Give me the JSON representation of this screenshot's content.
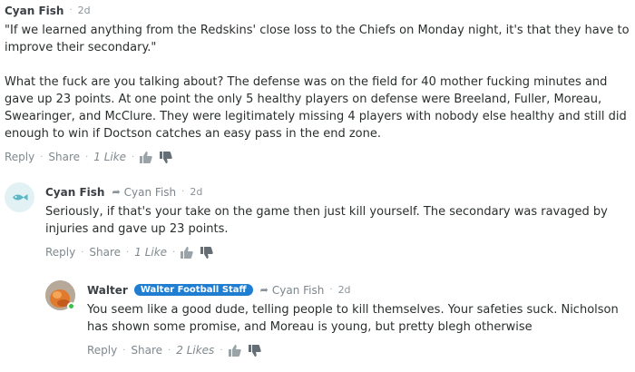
{
  "comments": [
    {
      "author": "Cyan Fish",
      "time": "2d",
      "paragraphs": [
        "\"If we learned anything from the Redskins' close loss to the Chiefs on Monday night, it's that they have to improve their secondary.\"",
        "What the fuck are you talking about? The defense was on the field for 40 mother fucking minutes and gave up 23 points. At one point the only 5 healthy players on defense were Breeland, Fuller, Moreau, Swearinger, and McClure. They were legitimately missing 4 players with nobody else healthy and still did enough to win if Doctson catches an easy pass in the end zone."
      ],
      "reply_label": "Reply",
      "share_label": "Share",
      "likes": "1 Like"
    },
    {
      "author": "Cyan Fish",
      "reply_to": "Cyan Fish",
      "time": "2d",
      "paragraphs": [
        "Seriously, if that's your take on the game then just kill yourself. The secondary was ravaged by injuries and gave up 23 points."
      ],
      "reply_label": "Reply",
      "share_label": "Share",
      "likes": "1 Like"
    },
    {
      "author": "Walter",
      "badge": "Walter Football Staff",
      "reply_to": "Cyan Fish",
      "time": "2d",
      "paragraphs": [
        "You seem like a good dude, telling people to kill themselves. Your safeties suck. Nicholson has shown some promise, and Moreau is young, but pretty blegh otherwise"
      ],
      "reply_label": "Reply",
      "share_label": "Share",
      "likes": "2 Likes"
    }
  ],
  "icons": {
    "upvote": "thumbs-up-icon",
    "downvote": "thumbs-down-icon",
    "reply_arrow": "reply-arrow-icon",
    "fish_avatar": "fish-icon"
  },
  "colors": {
    "badge": "#1f7ed2",
    "fish": "#5bb8c4",
    "online": "#3cbf4a"
  }
}
